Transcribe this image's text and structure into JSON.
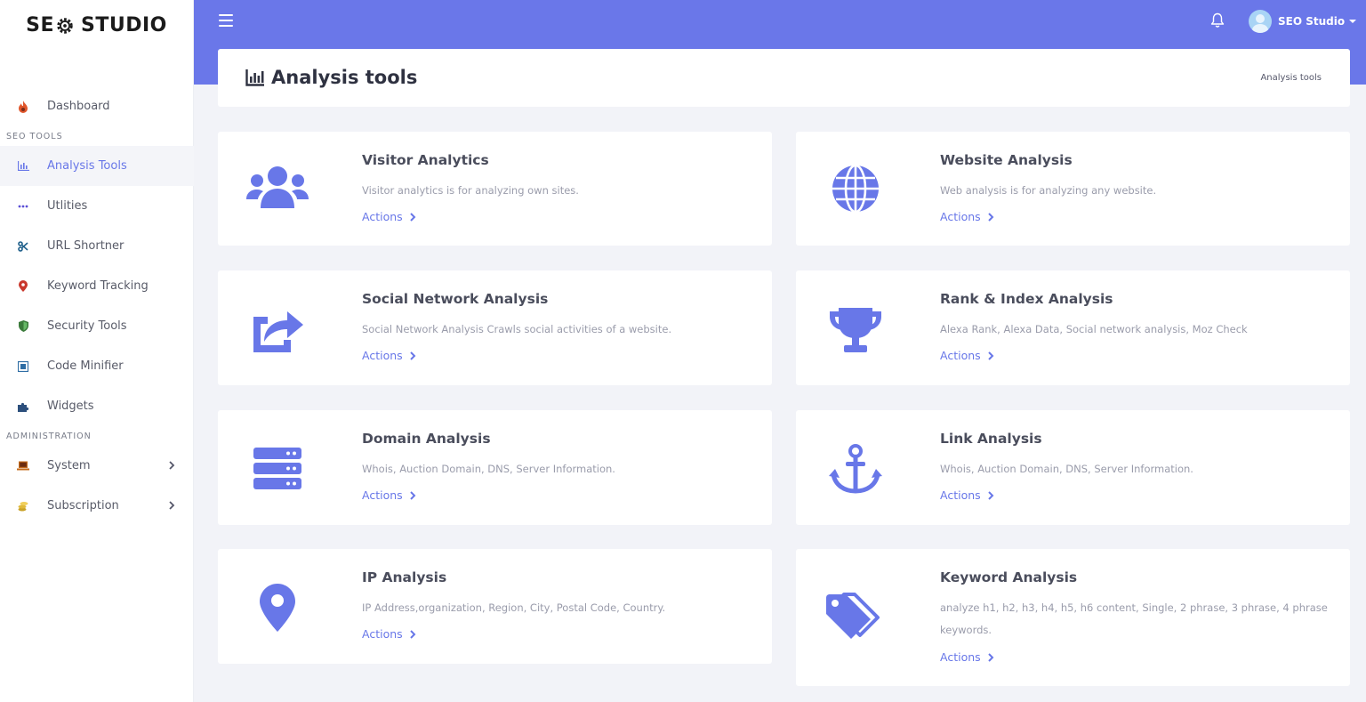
{
  "brand": {
    "logo_left": "SE",
    "logo_right": "STUDIO"
  },
  "sidebar": {
    "dashboard": "Dashboard",
    "section_seo": "SEO TOOLS",
    "items": [
      {
        "label": "Analysis Tools",
        "icon": "chart-icon"
      },
      {
        "label": "Utlities",
        "icon": "dots-icon"
      },
      {
        "label": "URL Shortner",
        "icon": "scissors-icon"
      },
      {
        "label": "Keyword Tracking",
        "icon": "map-pin-icon"
      },
      {
        "label": "Security Tools",
        "icon": "shield-icon"
      },
      {
        "label": "Code Minifier",
        "icon": "minifier-icon"
      },
      {
        "label": "Widgets",
        "icon": "puzzle-icon"
      }
    ],
    "section_admin": "ADMINISTRATION",
    "admin_items": [
      {
        "label": "System",
        "icon": "laptop-icon"
      },
      {
        "label": "Subscription",
        "icon": "coins-icon"
      }
    ]
  },
  "topbar": {
    "user_name": "SEO Studio"
  },
  "header": {
    "title": "Analysis tools",
    "breadcrumb": "Analysis tools"
  },
  "cards": [
    {
      "title": "Visitor Analytics",
      "desc": "Visitor analytics is for analyzing own sites.",
      "action": "Actions",
      "icon": "users-icon"
    },
    {
      "title": "Website Analysis",
      "desc": "Web analysis is for analyzing any website.",
      "action": "Actions",
      "icon": "globe-icon"
    },
    {
      "title": "Social Network Analysis",
      "desc": "Social Network Analysis Crawls social activities of a website.",
      "action": "Actions",
      "icon": "share-icon"
    },
    {
      "title": "Rank & Index Analysis",
      "desc": "Alexa Rank, Alexa Data, Social network analysis, Moz Check",
      "action": "Actions",
      "icon": "trophy-icon"
    },
    {
      "title": "Domain Analysis",
      "desc": "Whois, Auction Domain, DNS, Server Information.",
      "action": "Actions",
      "icon": "server-icon"
    },
    {
      "title": "Link Analysis",
      "desc": "Whois, Auction Domain, DNS, Server Information.",
      "action": "Actions",
      "icon": "anchor-icon"
    },
    {
      "title": "IP Analysis",
      "desc": "IP Address,organization, Region, City, Postal Code, Country.",
      "action": "Actions",
      "icon": "location-pin-icon"
    },
    {
      "title": "Keyword Analysis",
      "desc": "analyze h1, h2, h3, h4, h5, h6 content, Single, 2 phrase, 3 phrase, 4 phrase keywords.",
      "action": "Actions",
      "icon": "tags-icon"
    }
  ],
  "colors": {
    "accent": "#6a77e9",
    "icon": "#6877e8",
    "background": "#f2f3f8"
  }
}
